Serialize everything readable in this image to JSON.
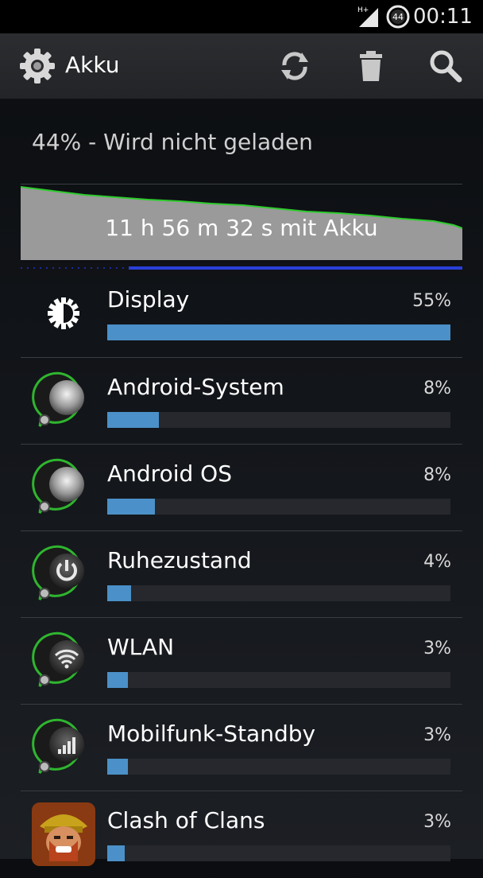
{
  "status_bar": {
    "network": "H+",
    "battery_level": "44",
    "time": "00:11"
  },
  "action_bar": {
    "title": "Akku",
    "icons": [
      "settings-gear-icon",
      "refresh-icon",
      "trash-icon",
      "search-icon"
    ]
  },
  "battery": {
    "status": "44% - Wird nicht geladen",
    "graph_label": "11 h 56 m 32 s mit Akku",
    "graph_colors": {
      "fill": "#9a9a9a",
      "line": "#2ecc2e",
      "charging": "#2a3fd8"
    }
  },
  "usage_items": [
    {
      "name": "Display",
      "percent_label": "55%",
      "value": 1.0,
      "icon": "brightness-icon"
    },
    {
      "name": "Android-System",
      "percent_label": "8%",
      "value": 0.15,
      "icon": "android-system-icon"
    },
    {
      "name": "Android OS",
      "percent_label": "8%",
      "value": 0.14,
      "icon": "android-os-icon"
    },
    {
      "name": "Ruhezustand",
      "percent_label": "4%",
      "value": 0.07,
      "icon": "power-icon"
    },
    {
      "name": "WLAN",
      "percent_label": "3%",
      "value": 0.06,
      "icon": "wifi-icon"
    },
    {
      "name": "Mobilfunk-Standby",
      "percent_label": "3%",
      "value": 0.06,
      "icon": "cell-signal-icon"
    },
    {
      "name": "Clash of Clans",
      "percent_label": "3%",
      "value": 0.05,
      "icon": "clash-of-clans-app-icon"
    }
  ],
  "colors": {
    "bar_fill": "#4b90c8",
    "bar_track": "#26282d",
    "icon_ring": "#2fb52f"
  }
}
